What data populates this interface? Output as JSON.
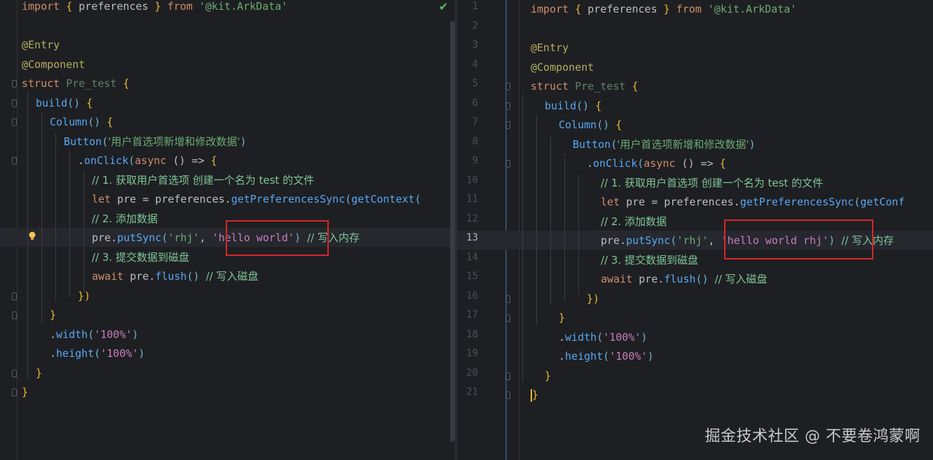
{
  "left": {
    "lines": [
      [
        "import ",
        "{ ",
        "preferences ",
        "} ",
        "from ",
        "'@kit.ArkData'"
      ],
      [],
      [
        "@Entry"
      ],
      [
        "@Component"
      ],
      [
        "struct ",
        "Pre_test ",
        "{"
      ],
      [
        "build",
        "() ",
        "{"
      ],
      [
        "Column",
        "() ",
        "{"
      ],
      [
        "Button",
        "(",
        "'用户首选项新增和修改数据'",
        ")"
      ],
      [
        ".",
        "onClick",
        "(",
        "async ",
        "() => ",
        "{"
      ],
      [
        "// 1. 获取用户首选项 创建一个名为 test 的文件"
      ],
      [
        "let ",
        "pre = preferences.",
        "getPreferencesSync",
        "(",
        "getContext",
        "("
      ],
      [
        "// 2. 添加数据"
      ],
      [
        "pre.",
        "putSync",
        "(",
        "'rhj'",
        ", ",
        "'hello world'",
        ") ",
        "// 写入内存"
      ],
      [
        "// 3. 提交数据到磁盘"
      ],
      [
        "await ",
        "pre.",
        "flush",
        "() ",
        "// 写入磁盘"
      ],
      [
        "})"
      ],
      [
        "}"
      ],
      [
        ".",
        "width",
        "(",
        "'100%'",
        ")"
      ],
      [
        ".",
        "height",
        "(",
        "'100%'",
        ")"
      ],
      [
        "}"
      ],
      [
        "}"
      ]
    ]
  },
  "right": {
    "line_numbers": [
      "1",
      "2",
      "3",
      "4",
      "5",
      "6",
      "7",
      "8",
      "9",
      "10",
      "11",
      "12",
      "13",
      "14",
      "15",
      "16",
      "17",
      "18",
      "19",
      "20",
      "21"
    ],
    "active_line": "13",
    "lines": [
      [
        "import ",
        "{ ",
        "preferences ",
        "} ",
        "from ",
        "'@kit.ArkData'"
      ],
      [],
      [
        "@Entry"
      ],
      [
        "@Component"
      ],
      [
        "struct ",
        "Pre_test ",
        "{"
      ],
      [
        "build",
        "() ",
        "{"
      ],
      [
        "Column",
        "() ",
        "{"
      ],
      [
        "Button",
        "(",
        "'用户首选项新增和修改数据'",
        ")"
      ],
      [
        ".",
        "onClick",
        "(",
        "async ",
        "() => ",
        "{"
      ],
      [
        "// 1. 获取用户首选项 创建一个名为 test 的文件"
      ],
      [
        "let ",
        "pre = preferences.",
        "getPreferencesSync",
        "(",
        "getConf"
      ],
      [
        "// 2. 添加数据"
      ],
      [
        "pre.",
        "putSync",
        "(",
        "'rhj'",
        ", ",
        "'hello world rhj'",
        ") ",
        "// 写入内存"
      ],
      [
        "// 3. 提交数据到磁盘"
      ],
      [
        "await ",
        "pre.",
        "flush",
        "() ",
        "// 写入磁盘"
      ],
      [
        "})"
      ],
      [
        "}"
      ],
      [
        ".",
        "width",
        "(",
        "'100%'",
        ")"
      ],
      [
        ".",
        "height",
        "(",
        "'100%'",
        ")"
      ],
      [
        "}"
      ],
      [
        "}"
      ]
    ]
  },
  "watermark": "掘金技术社区 @ 不要卷鸿蒙啊",
  "icons": {
    "status": "check-icon",
    "intention": "lightbulb-icon"
  },
  "colors": {
    "background": "#1e1f22",
    "keyword": "#cf8e6d",
    "string": "#6aab73",
    "comment": "#7ec699",
    "function": "#56a8f5",
    "highlight_box": "#d9262b"
  }
}
